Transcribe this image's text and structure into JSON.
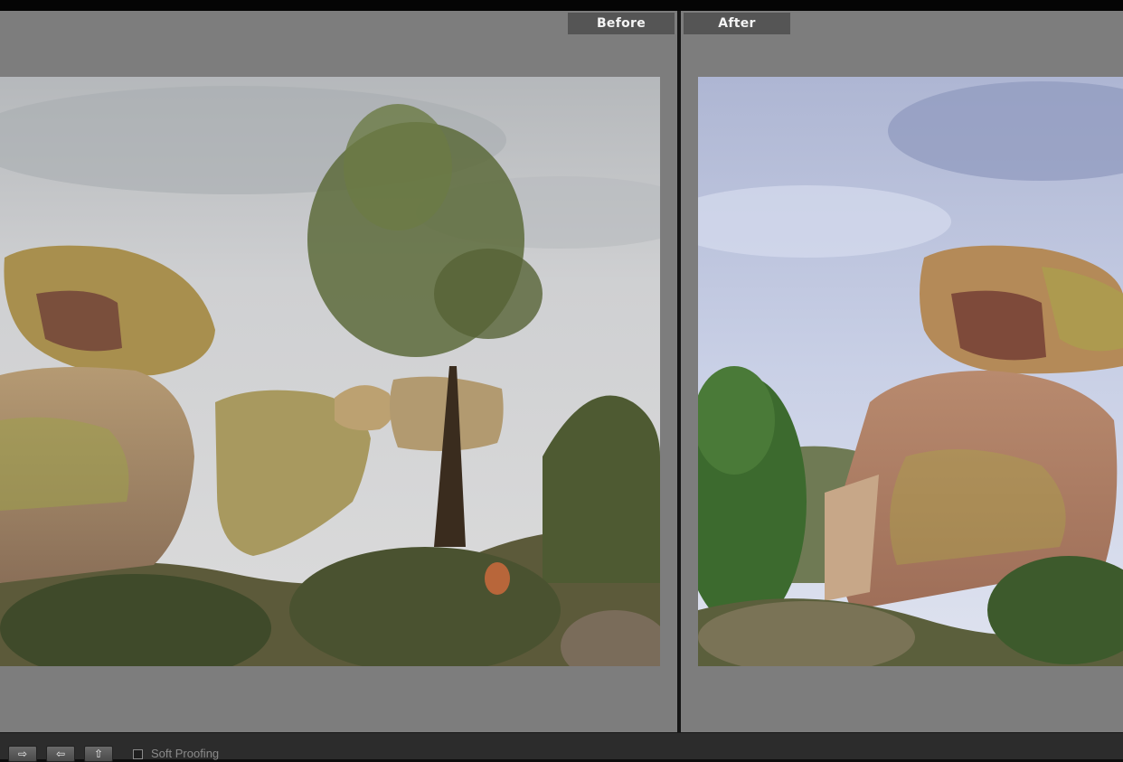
{
  "compare_view": {
    "before_label": "Before",
    "after_label": "After"
  },
  "toolbar": {
    "swap_icon": "swap-arrow-icon",
    "copy_to_left_icon": "copy-after-to-before-icon",
    "copy_to_right_icon": "copy-before-to-after-icon",
    "soft_proofing_label": "Soft Proofing",
    "soft_proofing_checked": false
  },
  "colors": {
    "panel_background": "#7d7d7d",
    "label_background": "#555555",
    "toolbar_background": "#2c2c2c"
  }
}
